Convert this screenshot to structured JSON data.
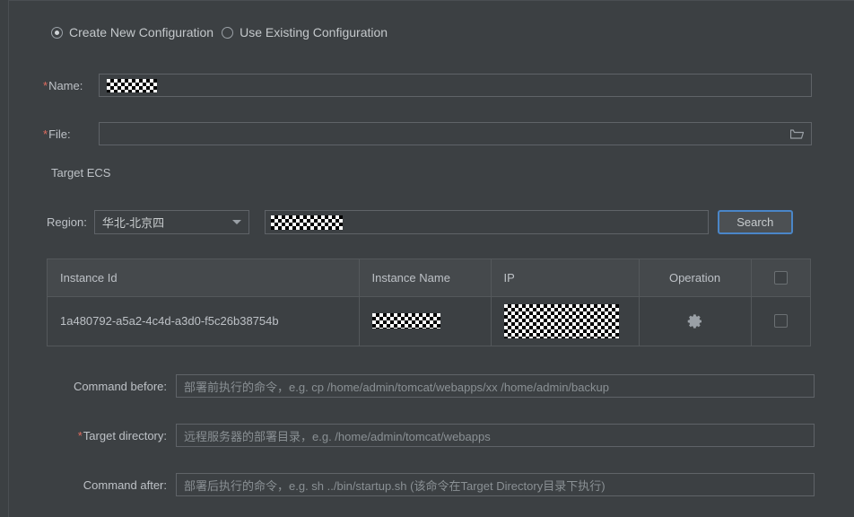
{
  "config_mode": {
    "options": [
      {
        "label": "Create New Configuration",
        "selected": true
      },
      {
        "label": "Use Existing Configuration",
        "selected": false
      }
    ]
  },
  "form": {
    "name": {
      "label": "Name:",
      "required_marker": "*",
      "value_redacted": true,
      "placeholder": ""
    },
    "file": {
      "label": "File:",
      "required_marker": "*",
      "value": "",
      "placeholder": "",
      "browse_icon": "folder-icon"
    }
  },
  "target_ecs": {
    "section_title": "Target ECS",
    "region": {
      "label": "Region:",
      "selected": "华北-北京四",
      "caret_icon": "chevron-down-icon"
    },
    "search": {
      "input_value_redacted": true,
      "button_label": "Search",
      "focus_color": "#4a86c8"
    },
    "table": {
      "columns": [
        "Instance Id",
        "Instance Name",
        "IP",
        "Operation",
        ""
      ],
      "select_all_checkbox": {
        "checked": false
      },
      "rows": [
        {
          "instance_id": "1a480792-a5a2-4c4d-a3d0-f5c26b38754b",
          "instance_name_redacted": true,
          "ip_redacted": true,
          "operation_icon": "gear-icon",
          "selected": false
        }
      ]
    }
  },
  "deploy": {
    "command_before": {
      "label": "Command before:",
      "required_marker": "",
      "value": "",
      "placeholder": "部署前执行的命令，e.g. cp /home/admin/tomcat/webapps/xx /home/admin/backup"
    },
    "target_directory": {
      "label": "Target directory:",
      "required_marker": "*",
      "value": "",
      "placeholder": "远程服务器的部署目录，e.g. /home/admin/tomcat/webapps"
    },
    "command_after": {
      "label": "Command after:",
      "required_marker": "",
      "value": "",
      "placeholder": "部署后执行的命令，e.g. sh ../bin/startup.sh (该命令在Target Directory目录下执行)"
    }
  },
  "theme": {
    "background": "#3c4043",
    "border": "#5f6368",
    "text": "#bdc1c6",
    "required_red": "#e06c5f",
    "accent_blue": "#4a86c8"
  }
}
